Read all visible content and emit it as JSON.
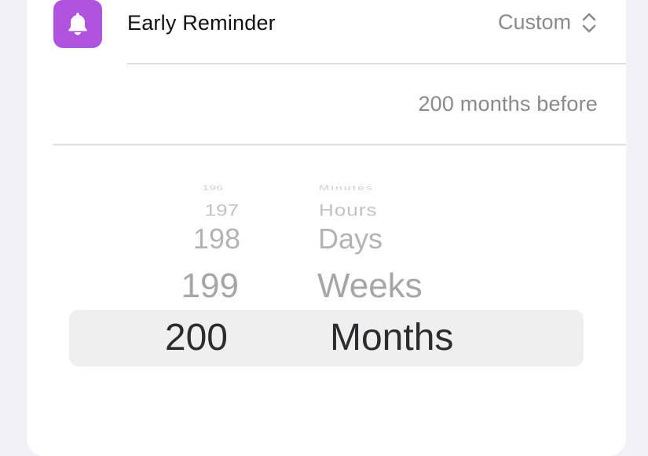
{
  "early_reminder": {
    "title": "Early Reminder",
    "value": "Custom",
    "summary": "200 months before",
    "icon": "bell-icon",
    "accent_color": "#af52de"
  },
  "picker": {
    "numbers": [
      "196",
      "197",
      "198",
      "199",
      "200"
    ],
    "units": [
      "Minutes",
      "Hours",
      "Days",
      "Weeks",
      "Months"
    ],
    "selected_number": "200",
    "selected_unit": "Months"
  }
}
